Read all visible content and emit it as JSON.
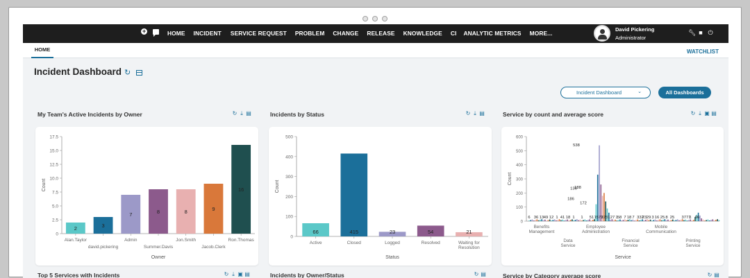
{
  "nav": {
    "items": [
      "HOME",
      "INCIDENT",
      "SERVICE REQUEST",
      "PROBLEM",
      "CHANGE",
      "RELEASE",
      "KNOWLEDGE",
      "CI",
      "ANALYTIC METRICS",
      "MORE..."
    ],
    "user_name": "David Pickering",
    "user_role": "Administrator",
    "icons": [
      "plus-icon",
      "chat-icon",
      "wrench-icon",
      "book-icon",
      "power-icon"
    ]
  },
  "tabs": {
    "home": "HOME",
    "watchlist": "WATCHLIST"
  },
  "page": {
    "title": "Incident Dashboard"
  },
  "controls": {
    "dashboard_select": "Incident Dashboard",
    "all_dashboards": "All Dashboards"
  },
  "panels": {
    "p1": "My Team's Active Incidents by Owner",
    "p2": "Incidents by Status",
    "p3": "Service by count and average score",
    "p4": "Top 5 Services with Incidents",
    "p5": "Incidents by Owner/Status",
    "p6": "Service by Category average score"
  },
  "colors": {
    "accent": "#1b6f9a",
    "nav_bg": "#1e1e1e"
  },
  "chart_data": [
    {
      "type": "bar",
      "categories": [
        "Alan.Taylor",
        "david.pickering",
        "Admin",
        "Summer.Davis",
        "Jon.Smith",
        "Jacob.Clerk",
        "Ron.Thomas"
      ],
      "values": [
        2,
        3,
        7,
        8,
        8,
        9,
        16
      ],
      "colors": [
        "#5bc8c8",
        "#1b6f9a",
        "#9c99c8",
        "#8c5a8c",
        "#e8b0b0",
        "#d9783a",
        "#1f4f4f"
      ],
      "xlabel": "Owner",
      "ylabel": "Count",
      "yticks": [
        "0",
        "2.5",
        "5.0",
        "7.5",
        "10.0",
        "12.5",
        "15.0",
        "17.5"
      ],
      "ylim": [
        0,
        17.5
      ]
    },
    {
      "type": "bar",
      "categories": [
        "Active",
        "Closed",
        "Logged",
        "Resolved",
        "Waiting for Resolution"
      ],
      "values": [
        66,
        415,
        23,
        54,
        21
      ],
      "colors": [
        "#5bc8c8",
        "#1b6f9a",
        "#9c99c8",
        "#8c5a8c",
        "#e8b0b0"
      ],
      "xlabel": "Status",
      "ylabel": "Count",
      "yticks": [
        "0",
        "100",
        "200",
        "300",
        "400",
        "500"
      ],
      "ylim": [
        0,
        500
      ]
    },
    {
      "type": "bar",
      "xlabel": "Service",
      "ylabel": "Count",
      "yticks": [
        "0",
        "100",
        "200",
        "300",
        "400",
        "500",
        "600"
      ],
      "ylim": [
        0,
        600
      ],
      "categories": [
        "Benefits Management",
        "Data Service",
        "Employee Administration",
        "Financial Service",
        "Mobile Communication",
        "Printing Service"
      ],
      "value_labels": [
        "6",
        "36",
        "13",
        "49",
        "12",
        "1",
        "41",
        "18",
        "1",
        "538",
        "136",
        "1",
        "186",
        "188",
        "172",
        "51",
        "1573",
        "2231",
        "27",
        "1",
        "58",
        "7",
        "18",
        "7",
        "332",
        "23",
        "29",
        "3",
        "16",
        "25",
        "8",
        "25",
        "3777",
        "1",
        "96"
      ],
      "peak_value": 538
    }
  ]
}
